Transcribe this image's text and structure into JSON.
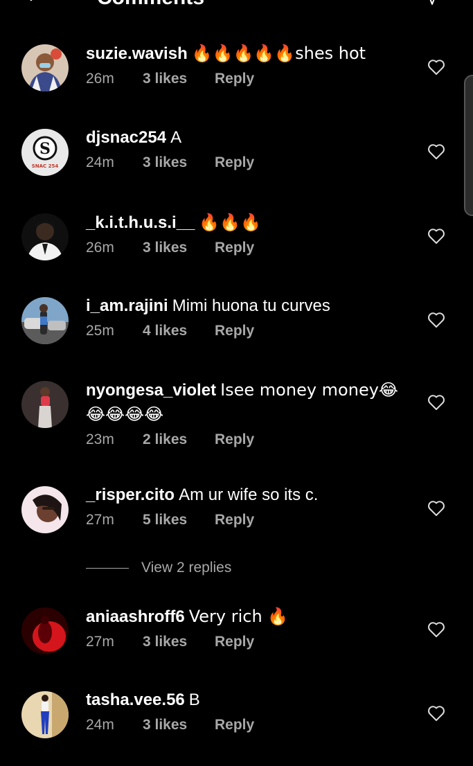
{
  "header": {
    "title": "Comments"
  },
  "comments": [
    {
      "username": "suzie.wavish",
      "text": "🔥🔥🔥🔥🔥shes hot",
      "time": "26m",
      "likes": "3 likes",
      "reply": "Reply"
    },
    {
      "username": "djsnac254",
      "text": "A",
      "time": "24m",
      "likes": "3 likes",
      "reply": "Reply",
      "avatar_text": "SNAC 254"
    },
    {
      "username": "_k.i.t.h.u.s.i__",
      "text": "🔥🔥🔥",
      "time": "26m",
      "likes": "3 likes",
      "reply": "Reply"
    },
    {
      "username": "i_am.rajini",
      "text": "Mimi huona tu curves",
      "time": "25m",
      "likes": "4 likes",
      "reply": "Reply"
    },
    {
      "username": "nyongesa_violet",
      "text": "Isee money money😂😂😂😂😂",
      "time": "23m",
      "likes": "2 likes",
      "reply": "Reply"
    },
    {
      "username": "_risper.cito",
      "text": "Am ur wife so its c.",
      "time": "27m",
      "likes": "5 likes",
      "reply": "Reply"
    },
    {
      "username": "aniaashroff6",
      "text": "Very rich 🔥",
      "time": "27m",
      "likes": "3 likes",
      "reply": "Reply"
    },
    {
      "username": "tasha.vee.56",
      "text": "B",
      "time": "24m",
      "likes": "3 likes",
      "reply": "Reply"
    }
  ],
  "view_replies": "View 2 replies",
  "icons": {
    "heart": "heart-outline-icon",
    "back": "back-arrow-icon",
    "share": "send-icon"
  },
  "colors": {
    "background": "#000000",
    "text": "#ffffff",
    "secondary": "#a8a8a8"
  }
}
